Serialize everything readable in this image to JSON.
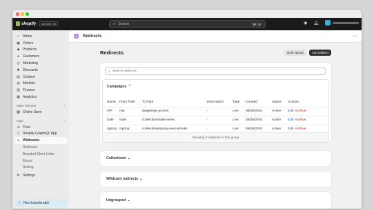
{
  "topbar": {
    "brand": "shopify",
    "edition": "Summer '25",
    "search_placeholder": "Search",
    "shortcut_keys": [
      "⌘",
      "K"
    ]
  },
  "sidebar": {
    "items": [
      {
        "label": "Home",
        "icon": "home-icon"
      },
      {
        "label": "Orders",
        "icon": "orders-icon"
      },
      {
        "label": "Products",
        "icon": "tag-icon"
      },
      {
        "label": "Customers",
        "icon": "person-icon"
      },
      {
        "label": "Marketing",
        "icon": "target-icon"
      },
      {
        "label": "Discounts",
        "icon": "discount-icon"
      },
      {
        "label": "Content",
        "icon": "content-icon"
      },
      {
        "label": "Markets",
        "icon": "globe-icon"
      },
      {
        "label": "Finance",
        "icon": "bank-icon"
      },
      {
        "label": "Analytics",
        "icon": "chart-icon"
      }
    ],
    "sales_channels_title": "Sales channels",
    "sales_channels": [
      {
        "label": "Online Store",
        "icon": "store-icon"
      }
    ],
    "apps_title": "Apps",
    "apps": [
      {
        "label": "Flow",
        "icon": "flow-icon"
      },
      {
        "label": "Shopify GraphiQL App",
        "icon": "graphql-icon"
      },
      {
        "label": "Wildcardo",
        "icon": "wildcardo-icon"
      }
    ],
    "app_subitems": [
      "Redirects",
      "Branded Short Links",
      "Errors",
      "Setting"
    ],
    "settings_label": "Settings",
    "non_transferable": "Non-transferable"
  },
  "app_header": {
    "title": "Redirects"
  },
  "page": {
    "title": "Redirects",
    "bulk_upload": "Bulk upload",
    "add_redirect": "Add redirect",
    "search_placeholder": "Search redirects"
  },
  "campaigns": {
    "title": "Campaigns",
    "columns": [
      "Name",
      "From Path",
      "To Path",
      "Description",
      "Type",
      "Created",
      "Status",
      "Actions"
    ],
    "rows": [
      {
        "name": "VIP",
        "from": "/vip",
        "to": "/pages/vip-access",
        "desc": "-",
        "type": "Live",
        "created": "08/06/2025",
        "status": "Active",
        "edit": "Edit",
        "archive": "Archive"
      },
      {
        "name": "Sale",
        "from": "/sale",
        "to": "/collections/sale-items",
        "desc": "-",
        "type": "Live",
        "created": "08/06/2025",
        "status": "Active",
        "edit": "Edit",
        "archive": "Archive"
      },
      {
        "name": "Spring",
        "from": "/spring",
        "to": "/collections/spring-new-arrivals",
        "desc": "-",
        "type": "Live",
        "created": "08/06/2025",
        "status": "Active",
        "edit": "Edit",
        "archive": "Archive"
      }
    ],
    "footer": "Showing 3 redirects in this group"
  },
  "groups": [
    {
      "title": "Collections"
    },
    {
      "title": "Wildcard redirects"
    },
    {
      "title": "Ungrouped"
    }
  ]
}
